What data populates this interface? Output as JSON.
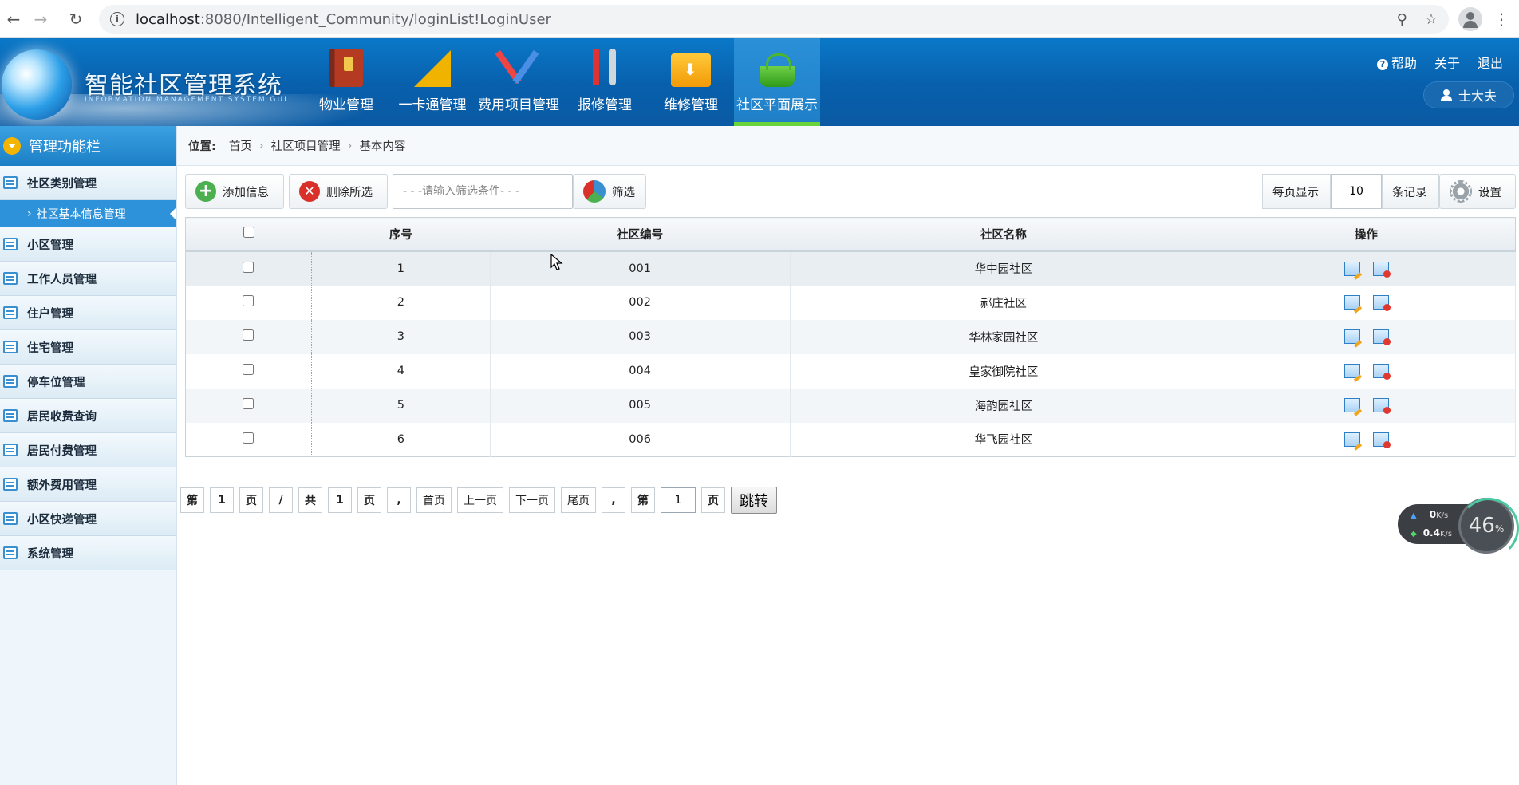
{
  "browser": {
    "url_host": "localhost",
    "url_path": ":8080/Intelligent_Community/loginList!LoginUser"
  },
  "header": {
    "title": "智能社区管理系统",
    "subtitle": "INFORMATION MANAGEMENT SYSTEM GUI",
    "nav": [
      {
        "label": "物业管理",
        "icon": "book-icon"
      },
      {
        "label": "一卡通管理",
        "icon": "ruler-icon"
      },
      {
        "label": "费用项目管理",
        "icon": "drafting-tools-icon"
      },
      {
        "label": "报修管理",
        "icon": "screwdriver-wrench-icon"
      },
      {
        "label": "维修管理",
        "icon": "folder-download-icon"
      },
      {
        "label": "社区平面展示",
        "icon": "basket-icon",
        "active": true
      }
    ],
    "help": "帮助",
    "about": "关于",
    "logout": "退出",
    "user": "士大夫"
  },
  "sidebar": {
    "title": "管理功能栏",
    "items": [
      {
        "label": "社区类别管理"
      },
      {
        "label": "社区基本信息管理",
        "sub": true
      },
      {
        "label": "小区管理"
      },
      {
        "label": "工作人员管理"
      },
      {
        "label": "住户管理"
      },
      {
        "label": "住宅管理"
      },
      {
        "label": "停车位管理"
      },
      {
        "label": "居民收费查询"
      },
      {
        "label": "居民付费管理"
      },
      {
        "label": "额外费用管理"
      },
      {
        "label": "小区快递管理"
      },
      {
        "label": "系统管理"
      }
    ]
  },
  "breadcrumb": {
    "label": "位置:",
    "items": [
      "首页",
      "社区项目管理",
      "基本内容"
    ]
  },
  "toolbar": {
    "add": "添加信息",
    "delete": "删除所选",
    "filter_placeholder": "- - -请输入筛选条件- - -",
    "filter_btn": "筛选",
    "per_page_label": "每页显示",
    "per_page_value": "10",
    "records_label": "条记录",
    "settings": "设置"
  },
  "table": {
    "headers": [
      "序号",
      "社区编号",
      "社区名称",
      "操作"
    ],
    "rows": [
      {
        "seq": "1",
        "code": "001",
        "name": "华中园社区"
      },
      {
        "seq": "2",
        "code": "002",
        "name": "郝庄社区"
      },
      {
        "seq": "3",
        "code": "003",
        "name": "华林家园社区"
      },
      {
        "seq": "4",
        "code": "004",
        "name": "皇家御院社区"
      },
      {
        "seq": "5",
        "code": "005",
        "name": "海韵园社区"
      },
      {
        "seq": "6",
        "code": "006",
        "name": "华飞园社区"
      }
    ]
  },
  "pager": {
    "di": "第",
    "page_no": "1",
    "ye": "页",
    "slash": "/",
    "gong": "共",
    "total": "1",
    "ye2": "页",
    "comma": ",",
    "first": "首页",
    "prev": "上一页",
    "next": "下一页",
    "last": "尾页",
    "comma2": ",",
    "di2": "第",
    "jump_value": "1",
    "ye3": "页",
    "jump": "跳转"
  },
  "net_widget": {
    "up": "0",
    "up_unit": "K/s",
    "down": "0.4",
    "down_unit": "K/s",
    "pct": "46",
    "pct_unit": "%"
  }
}
